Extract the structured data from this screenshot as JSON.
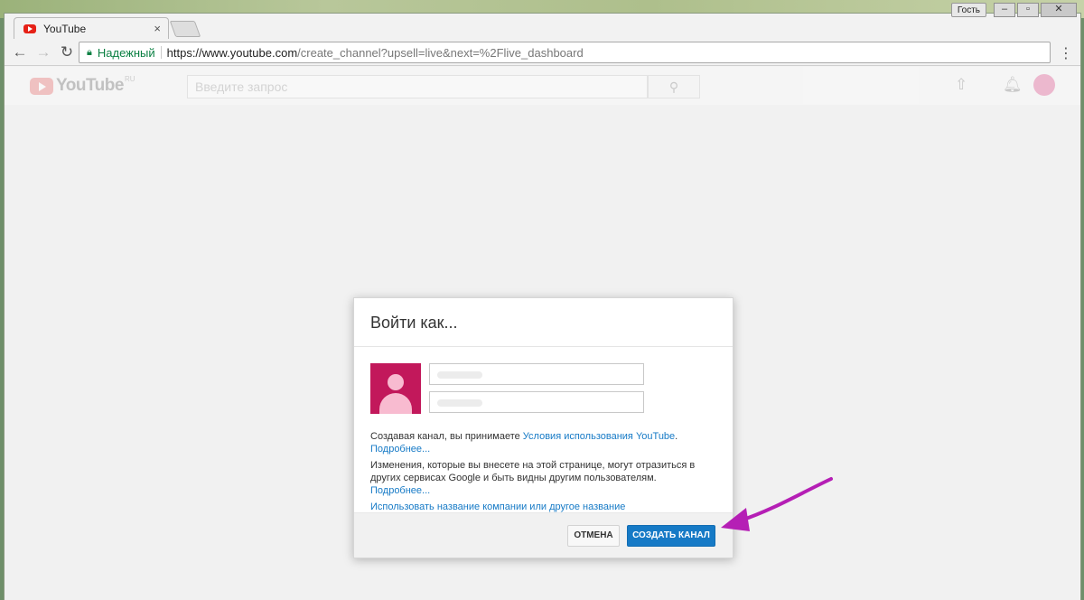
{
  "browser": {
    "tab_title": "YouTube",
    "tab_close": "×",
    "profile_label": "Гость",
    "address": {
      "security_label": "Надежный",
      "url_host": "https://www.youtube.com",
      "url_path": "/create_channel?upsell=live&next=%2Flive_dashboard"
    },
    "icons": {
      "back": "arrow-left-icon",
      "forward": "arrow-right-icon",
      "reload": "reload-icon",
      "lock": "lock-icon",
      "menu": "menu-dots-icon"
    }
  },
  "youtube_header": {
    "logo_text": "YouTube",
    "logo_region": "RU",
    "search_placeholder": "Введите запрос",
    "icons": [
      "search-icon",
      "upload-icon",
      "bell-icon",
      "avatar"
    ]
  },
  "dialog": {
    "title": "Войти как...",
    "first_name_value": "",
    "last_name_value": "",
    "terms_prefix": "Создавая канал, вы принимаете ",
    "terms_link": "Условия использования YouTube",
    "terms_suffix": ".",
    "more_link_1": "Подробнее...",
    "changes_text": "Изменения, которые вы внесете на этой странице, могут отразиться в других сервисах Google и быть видны другим пользователям. ",
    "more_link_2": "Подробнее...",
    "use_business_name_link": "Использовать название компании или другое название",
    "cancel_label": "ОТМЕНА",
    "create_label": "СОЗДАТЬ КАНАЛ"
  },
  "colors": {
    "primary_button": "#167ac6",
    "avatar_bg": "#c2185b",
    "annotation_arrow": "#b51fb5",
    "secure_green": "#0b8043"
  }
}
